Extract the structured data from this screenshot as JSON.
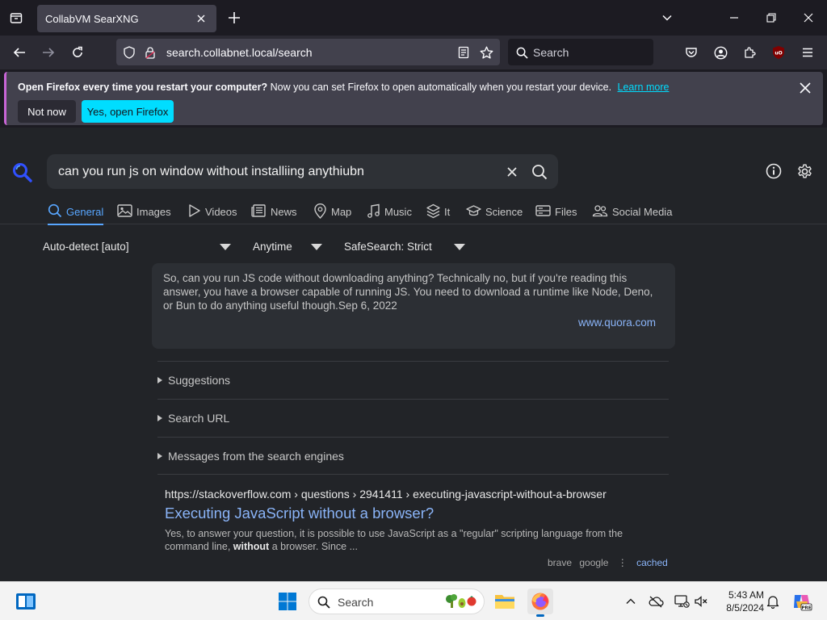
{
  "tab": {
    "title": "CollabVM SearXNG"
  },
  "navbar": {
    "url": "search.collabnet.local/search",
    "search_placeholder": "Search"
  },
  "notification": {
    "bold": "Open Firefox every time you restart your computer?",
    "text": "Now you can set Firefox to open automatically when you restart your device.",
    "link": "Learn more",
    "not_now": "Not now",
    "open": "Yes, open Firefox"
  },
  "search": {
    "query": "can you run js on window without installiing anythiubn"
  },
  "categories": [
    {
      "label": "General",
      "icon": "search-icon"
    },
    {
      "label": "Images",
      "icon": "image-icon"
    },
    {
      "label": "Videos",
      "icon": "play-icon"
    },
    {
      "label": "News",
      "icon": "newspaper-icon"
    },
    {
      "label": "Map",
      "icon": "map-pin-icon"
    },
    {
      "label": "Music",
      "icon": "music-icon"
    },
    {
      "label": "It",
      "icon": "layers-icon"
    },
    {
      "label": "Science",
      "icon": "graduation-icon"
    },
    {
      "label": "Files",
      "icon": "drive-icon"
    },
    {
      "label": "Social Media",
      "icon": "people-icon"
    }
  ],
  "filters": {
    "language": "Auto-detect [auto]",
    "time": "Anytime",
    "safesearch": "SafeSearch: Strict"
  },
  "answer": {
    "text": "So, can you run JS code without downloading anything? Technically no, but if you're reading this answer, you have a browser capable of running JS. You need to download a runtime like Node, Deno, or Bun to do anything useful though.Sep 6, 2022",
    "source": "www.quora.com"
  },
  "sections": [
    "Suggestions",
    "Search URL",
    "Messages from the search engines"
  ],
  "result": {
    "url": "https://stackoverflow.com  › questions › 2941411 › executing-javascript-without-a-browser",
    "title": "Executing JavaScript without a browser?",
    "snippet_pre": "Yes, to answer your question, it is possible to use JavaScript as a \"regular\" scripting language from the command line,",
    "snippet_bold": "without",
    "snippet_post": "a browser. Since ...",
    "engine1": "brave",
    "engine2": "google",
    "cached": "cached"
  },
  "taskbar": {
    "search": "Search",
    "time": "5:43 AM",
    "date": "8/5/2024"
  },
  "colors": {
    "accent": "#58a6ff",
    "link": "#8ab4f8",
    "cyan": "#00ddff",
    "notif_border": "#c865d6"
  }
}
